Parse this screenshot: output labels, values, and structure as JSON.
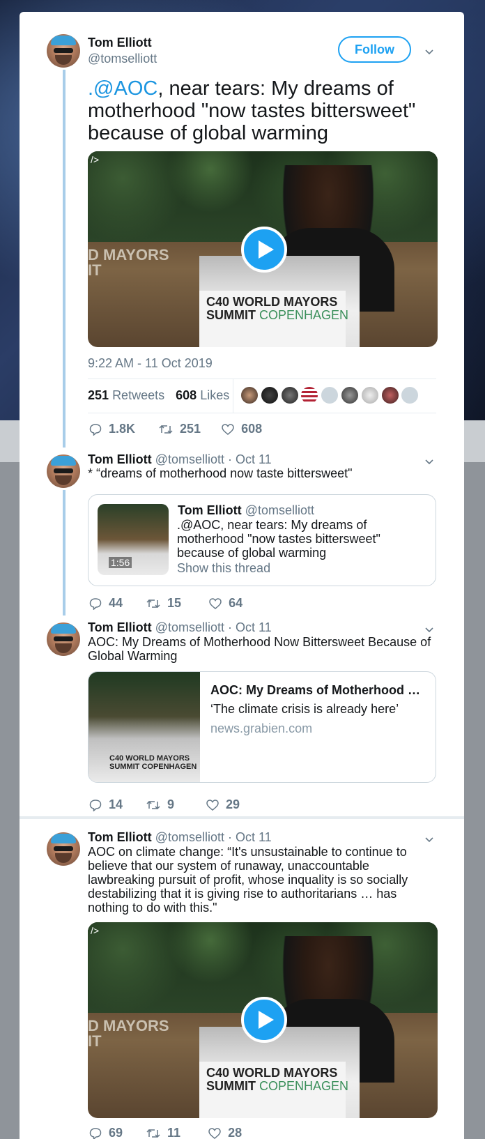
{
  "tweet1": {
    "name": "Tom Elliott",
    "handle": "@tomselliott",
    "follow_label": "Follow",
    "text_mention": ".@AOC",
    "text_rest_line1": ", near tears: My dreams of",
    "text_line2": "motherhood \"now tastes bittersweet\"",
    "text_line3": "because of global warming",
    "timestamp": "9:22 AM - 11 Oct 2019",
    "retweets_count": "251",
    "retweets_label": "Retweets",
    "likes_count": "608",
    "likes_label": "Likes",
    "replies": "1.8K",
    "retweets": "251",
    "likes": "608",
    "video_banner": "D MAYORS\nIT",
    "video_sign_line1": "C40 WORLD MAYORS",
    "video_sign_line2_bold": "SUMMIT",
    "video_sign_line2_rest": "COPENHAGEN"
  },
  "tweet2": {
    "name": "Tom Elliott",
    "meta": "@tomselliott · Oct 11",
    "text": "* “dreams of motherhood now taste bittersweet\"",
    "quote_name": "Tom Elliott",
    "quote_handle": "@tomselliott",
    "quote_line1": ".@AOC, near tears: My dreams of",
    "quote_line2": "motherhood \"now tastes bittersweet\"",
    "quote_line3": "because of global warming",
    "quote_show_thread": "Show this thread",
    "quote_duration": "1:56",
    "replies": "44",
    "retweets": "15",
    "likes": "64"
  },
  "tweet3": {
    "name": "Tom Elliott",
    "meta": "@tomselliott · Oct 11",
    "text_line1": "AOC: My Dreams of Motherhood Now Bittersweet Because of",
    "text_line2": "Global Warming",
    "card_title": "AOC: My Dreams of Motherhood …",
    "card_desc": "‘The climate crisis is already here’",
    "card_domain": "news.grabien.com",
    "replies": "14",
    "retweets": "9",
    "likes": "29"
  },
  "tweet4": {
    "name": "Tom Elliott",
    "meta": "@tomselliott · Oct 11",
    "text_line1": "AOC on climate change: “It's unsustainable to continue to",
    "text_line2": "believe that our system of runaway, unaccountable",
    "text_line3": "lawbreaking pursuit of profit, whose inquality is so socially",
    "text_line4": "destabilizing that it is giving rise to authoritarians … has",
    "text_line5": "nothing to do with this.\"",
    "replies": "69",
    "retweets": "11",
    "likes": "28"
  },
  "colors": {
    "accent": "#1da1f2",
    "thread_line": "#a8cde9",
    "secondary_text": "#657786",
    "primary_text": "#14171a"
  },
  "icons": [
    "reply-icon",
    "retweet-icon",
    "like-icon",
    "chevron-down-icon",
    "play-icon"
  ]
}
